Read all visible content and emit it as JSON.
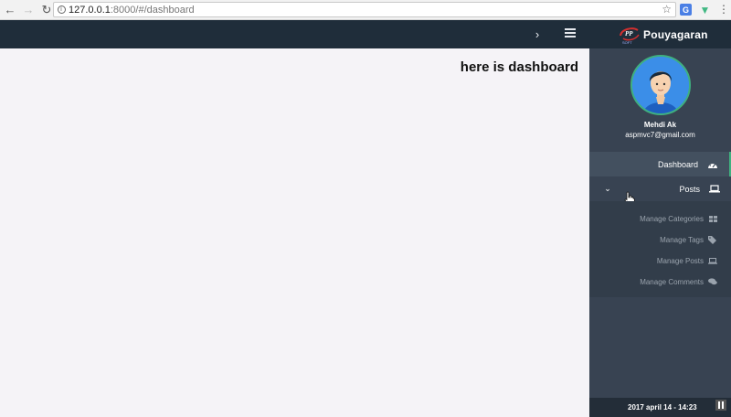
{
  "browser": {
    "url_host": "127.0.0.1",
    "url_path": ":8000/#/dashboard"
  },
  "brand": {
    "name": "Pouyagaran",
    "tagline": "SOFT"
  },
  "main": {
    "title": "here is dashboard"
  },
  "user": {
    "name": "Mehdi Ak",
    "email": "aspmvc7@gmail.com"
  },
  "sidebar": {
    "items": [
      {
        "label": "Dashboard",
        "icon": "tachometer-icon",
        "active": true
      },
      {
        "label": "Posts",
        "icon": "laptop-icon",
        "expanded": true
      }
    ],
    "submenu": [
      {
        "label": "Manage Categories",
        "icon": "grid-icon"
      },
      {
        "label": "Manage Tags",
        "icon": "tags-icon"
      },
      {
        "label": "Manage Posts",
        "icon": "laptop-icon"
      },
      {
        "label": "Manage Comments",
        "icon": "comments-icon"
      }
    ],
    "footer": "2017 april 14 - 14:23"
  },
  "colors": {
    "topbar": "#1f2d3a",
    "sidebar": "#384352",
    "accent": "#3fb07f",
    "content_bg": "#f5f3f7"
  }
}
